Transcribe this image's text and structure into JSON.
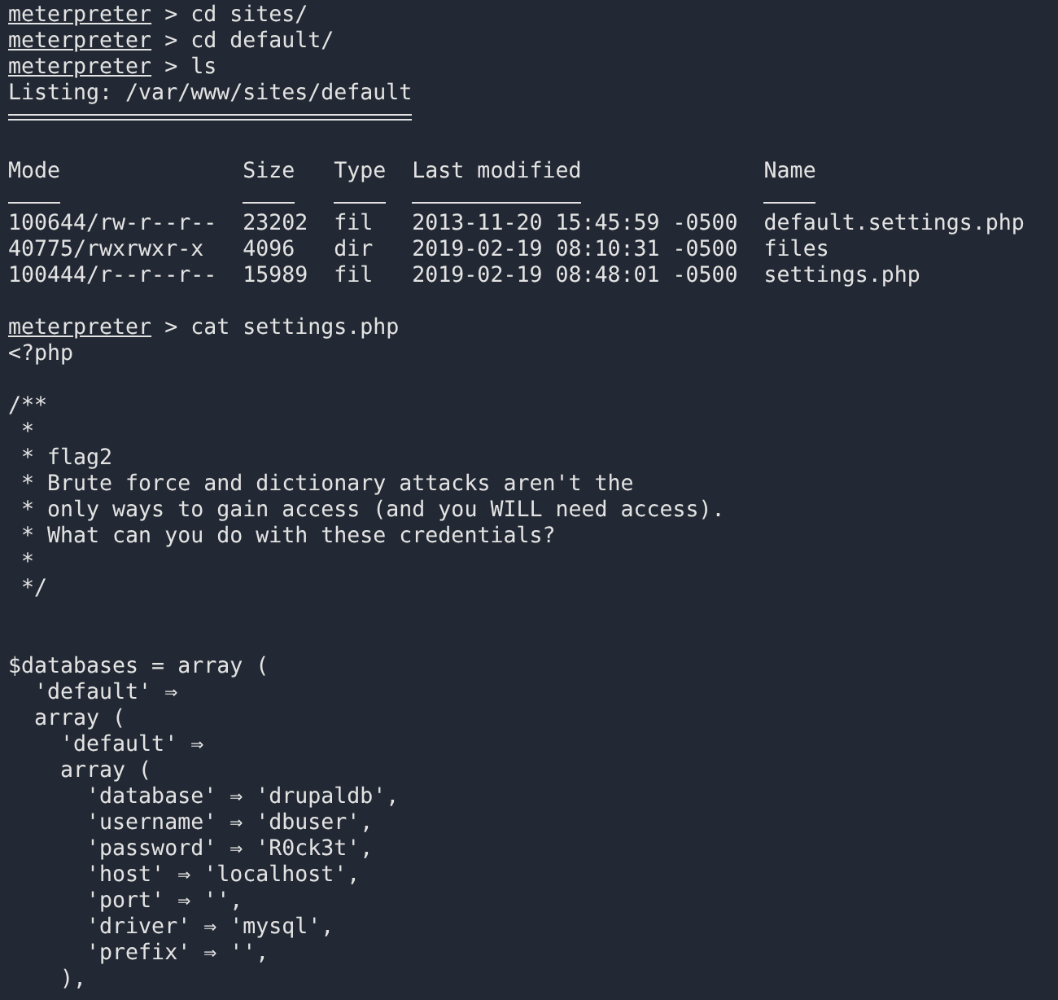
{
  "commands": [
    {
      "prompt": "meterpreter",
      "command": "> cd sites/"
    },
    {
      "prompt": "meterpreter",
      "command": "> cd default/"
    },
    {
      "prompt": "meterpreter",
      "command": "> ls"
    }
  ],
  "listing": {
    "title": "Listing: /var/www/sites/default",
    "columns": [
      "Mode",
      "Size",
      "Type",
      "Last modified",
      "Name"
    ],
    "rows": [
      [
        "100644/rw-r--r--",
        "23202",
        "fil",
        "2013-11-20 15:45:59 -0500",
        "default.settings.php"
      ],
      [
        "40775/rwxrwxr-x",
        "4096",
        "dir",
        "2019-02-19 08:10:31 -0500",
        "files"
      ],
      [
        "100444/r--r--r--",
        "15989",
        "fil",
        "2019-02-19 08:48:01 -0500",
        "settings.php"
      ]
    ]
  },
  "output": [
    {
      "kind": "blank"
    },
    {
      "kind": "prompt",
      "prompt": "meterpreter",
      "command": "> cat settings.php"
    },
    {
      "kind": "text",
      "text": "<?php"
    },
    {
      "kind": "blank"
    },
    {
      "kind": "text",
      "text": "/**"
    },
    {
      "kind": "text",
      "text": " *"
    },
    {
      "kind": "text",
      "text": " * flag2"
    },
    {
      "kind": "text",
      "text": " * Brute force and dictionary attacks aren't the"
    },
    {
      "kind": "text",
      "text": " * only ways to gain access (and you WILL need access)."
    },
    {
      "kind": "text",
      "text": " * What can you do with these credentials?"
    },
    {
      "kind": "text",
      "text": " *"
    },
    {
      "kind": "text",
      "text": " */"
    },
    {
      "kind": "blank"
    },
    {
      "kind": "blank"
    },
    {
      "kind": "text",
      "text": "$databases = array ("
    },
    {
      "kind": "text",
      "text": "  'default' ⇒"
    },
    {
      "kind": "text",
      "text": "  array ("
    },
    {
      "kind": "text",
      "text": "    'default' ⇒"
    },
    {
      "kind": "text",
      "text": "    array ("
    },
    {
      "kind": "text",
      "text": "      'database' ⇒ 'drupaldb',"
    },
    {
      "kind": "text",
      "text": "      'username' ⇒ 'dbuser',"
    },
    {
      "kind": "text",
      "text": "      'password' ⇒ 'R0ck3t',"
    },
    {
      "kind": "text",
      "text": "      'host' ⇒ 'localhost',"
    },
    {
      "kind": "text",
      "text": "      'port' ⇒ '',"
    },
    {
      "kind": "text",
      "text": "      'driver' ⇒ 'mysql',"
    },
    {
      "kind": "text",
      "text": "      'prefix' ⇒ '',"
    },
    {
      "kind": "text",
      "text": "    ),"
    }
  ]
}
